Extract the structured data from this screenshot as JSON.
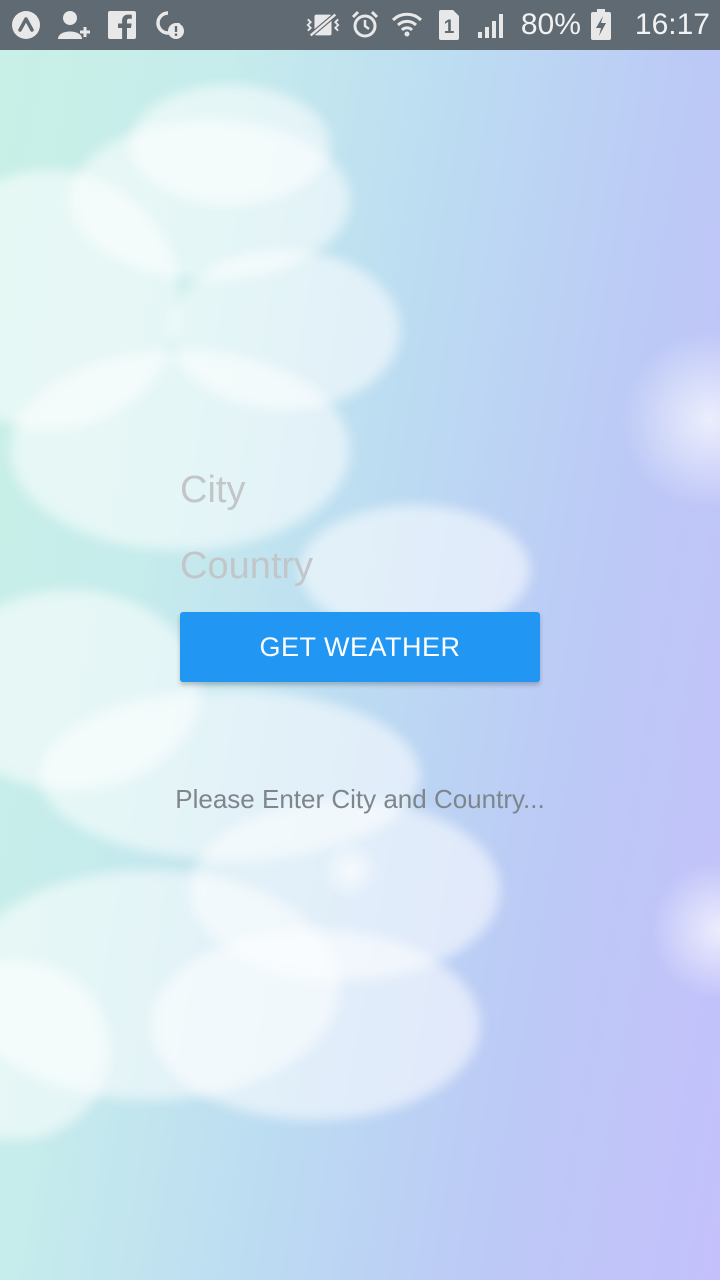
{
  "status_bar": {
    "left_icons": [
      "a-icon",
      "add-contact-icon",
      "facebook-icon",
      "sync-alert-icon"
    ],
    "right_icons": [
      "vibrate-icon",
      "alarm-icon",
      "wifi-icon",
      "sim-icon",
      "signal-icon",
      "battery-charging-icon"
    ],
    "sim_number": "1",
    "battery": "80%",
    "time": "16:17"
  },
  "form": {
    "city_placeholder": "City",
    "city_value": "",
    "country_placeholder": "Country",
    "country_value": "",
    "button_label": "GET WEATHER"
  },
  "message": "Please Enter City and Country...",
  "colors": {
    "accent": "#2196f3",
    "status_bar": "#5f6a72",
    "placeholder": "#c3c6c9",
    "message": "#7e858b"
  }
}
